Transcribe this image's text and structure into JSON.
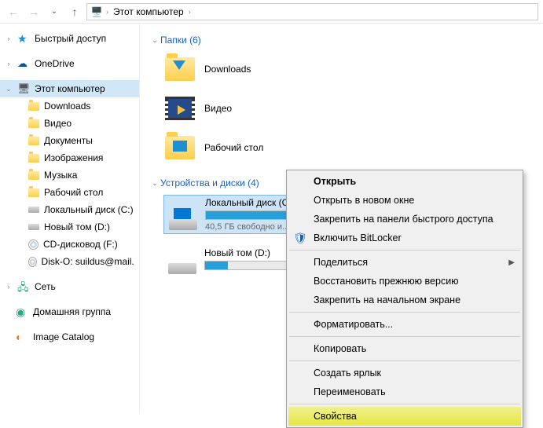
{
  "addressbar": {
    "crumbs": [
      "Этот компьютер"
    ]
  },
  "sidebar": {
    "quick_access": "Быстрый доступ",
    "onedrive": "OneDrive",
    "this_pc": "Этот компьютер",
    "items": [
      "Downloads",
      "Видео",
      "Документы",
      "Изображения",
      "Музыка",
      "Рабочий стол",
      "Локальный диск (C:)",
      "Новый том (D:)",
      "CD-дисковод (F:)",
      "Disk-O: suildus@mail.ru (O:)"
    ],
    "network": "Сеть",
    "homegroup": "Домашняя группа",
    "image_catalog": "Image Catalog"
  },
  "main": {
    "folders_header": "Папки (6)",
    "folders": [
      {
        "name": "Downloads",
        "icon": "downloads"
      },
      {
        "name": "Видео",
        "icon": "video"
      },
      {
        "name": "Рабочий стол",
        "icon": "desktop"
      }
    ],
    "drives_header": "Устройства и диски (4)",
    "drives": [
      {
        "name": "Локальный диск (C:)",
        "free": "40,5 ГБ свободно и...",
        "fill_pct": 65,
        "selected": true
      },
      {
        "name": "Новый том (D:)",
        "free": "",
        "fill_pct": 18,
        "selected": false
      }
    ]
  },
  "ctxmenu": {
    "open": "Открыть",
    "open_new": "Открыть в новом окне",
    "pin_quick": "Закрепить на панели быстрого доступа",
    "bitlocker": "Включить BitLocker",
    "share": "Поделиться",
    "restore": "Восстановить прежнюю версию",
    "pin_start": "Закрепить на начальном экране",
    "format": "Форматировать...",
    "copy": "Копировать",
    "shortcut": "Создать ярлык",
    "rename": "Переименовать",
    "properties": "Свойства"
  }
}
